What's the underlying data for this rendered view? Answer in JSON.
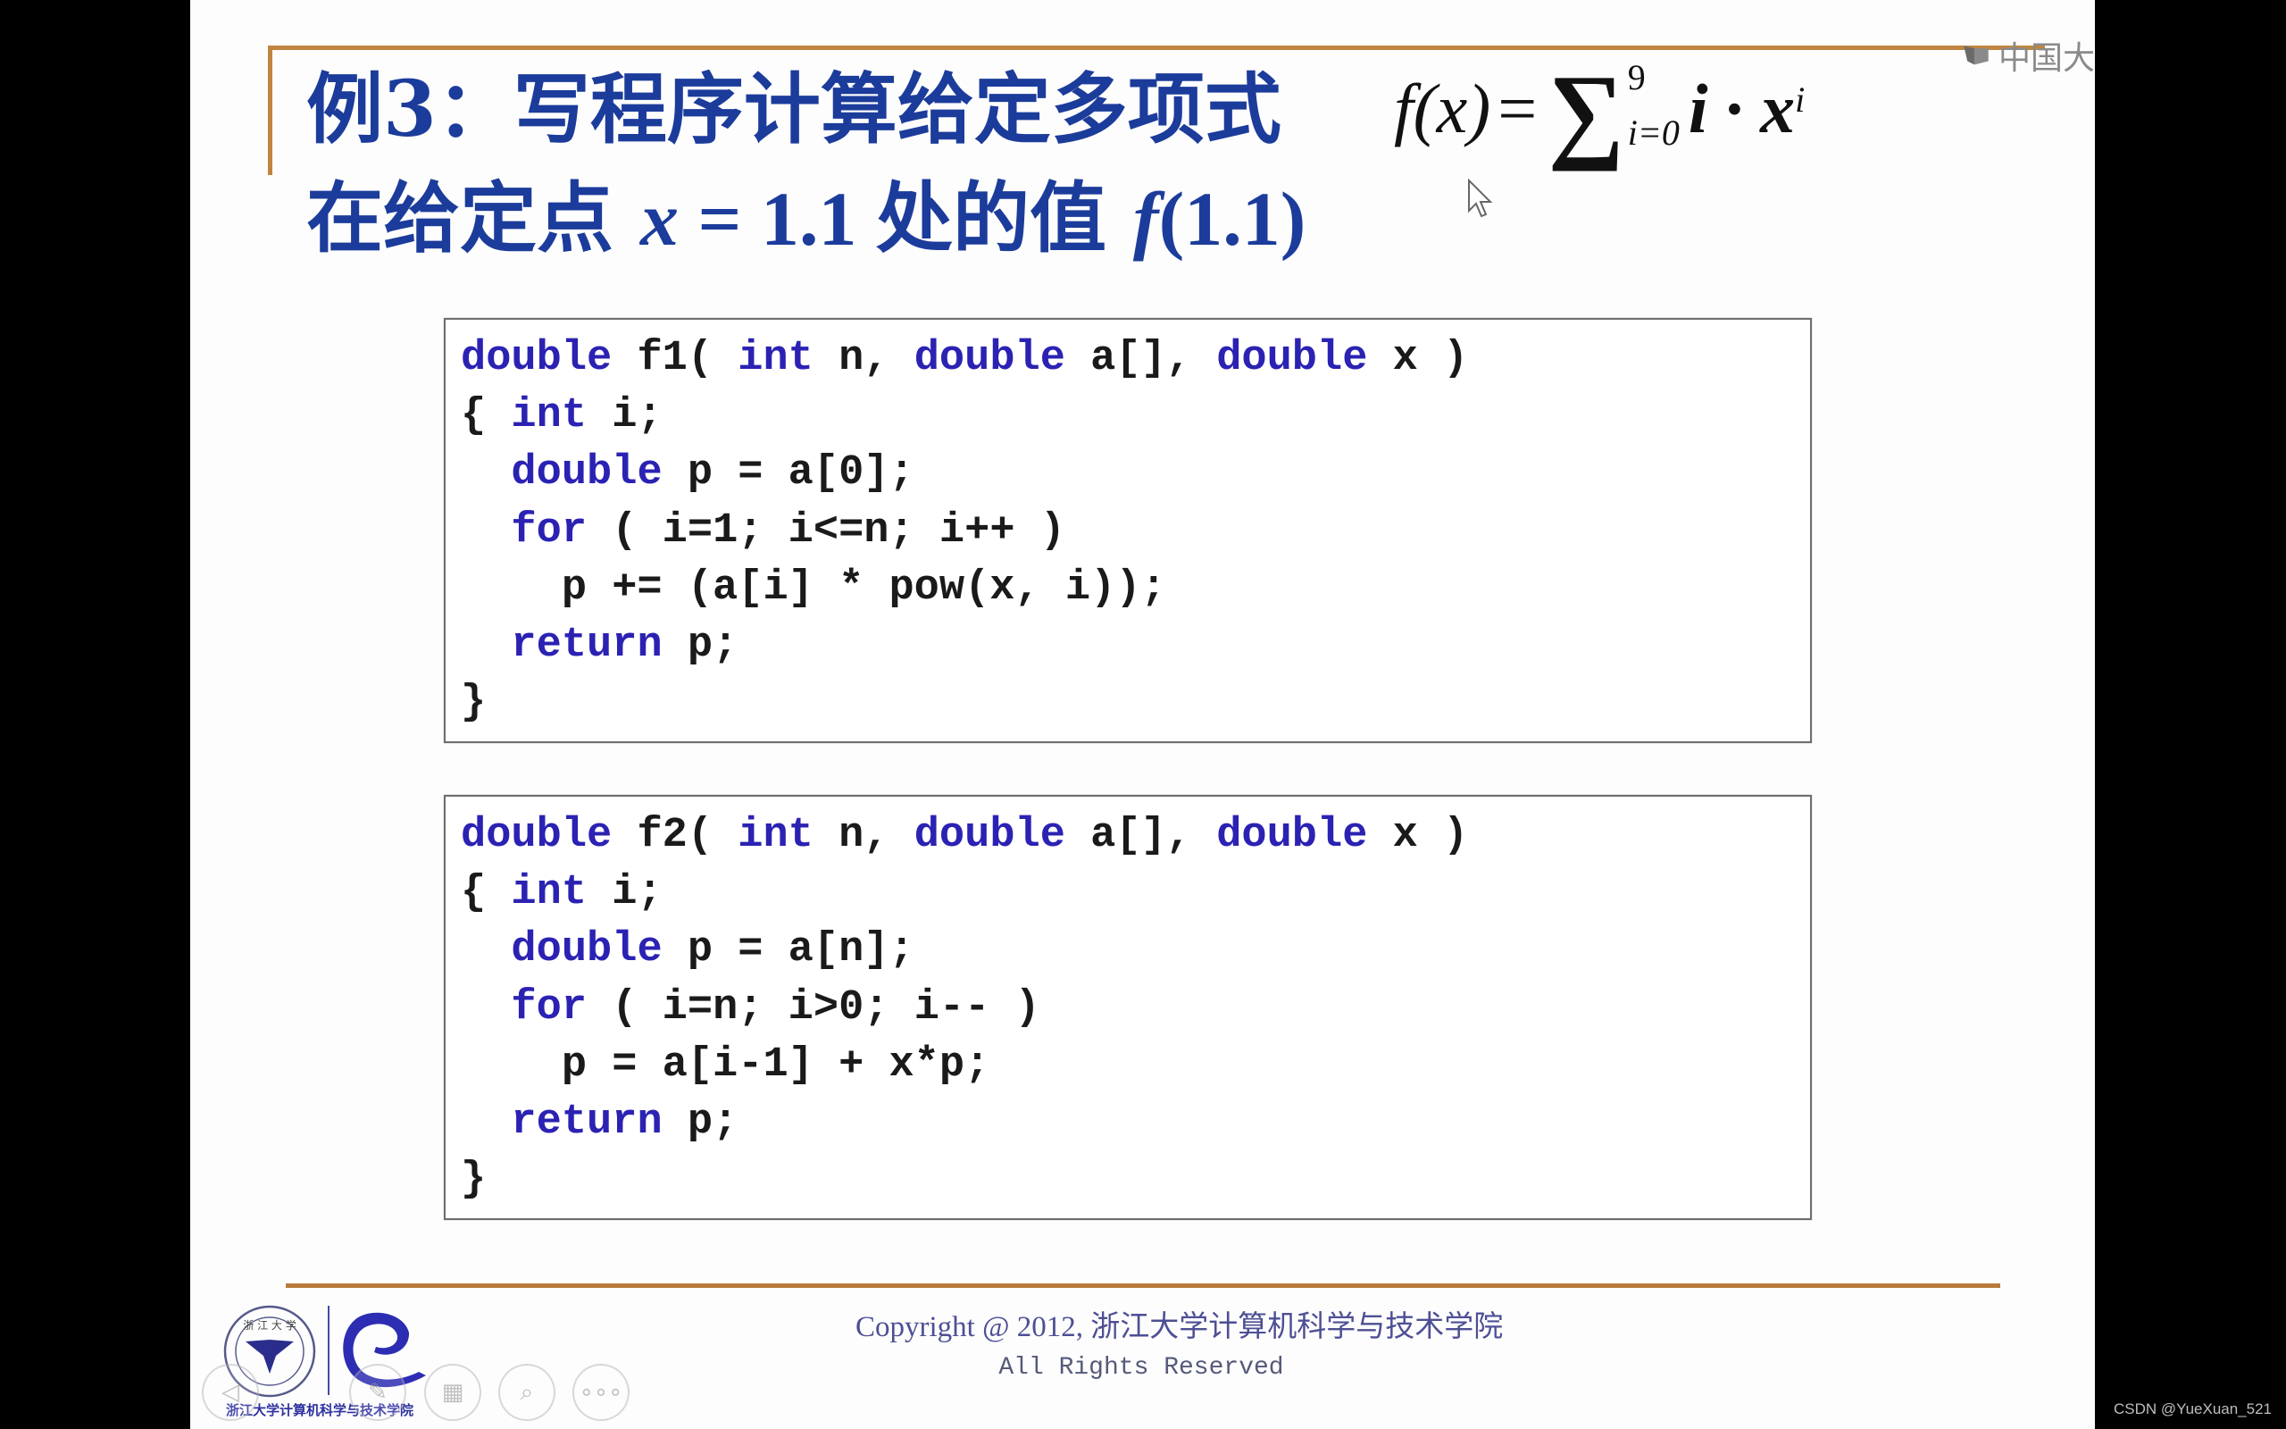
{
  "watermark": {
    "text": "中国大",
    "icon": "monitor-logo-icon"
  },
  "title": {
    "line1": "例3：写程序计算给定多项式",
    "line2_prefix": "在给定点",
    "line2_var": "x",
    "line2_eq": " = 1.1 ",
    "line2_mid": "处的值",
    "line2_f": "f",
    "line2_arg": "(1.1)"
  },
  "formula": {
    "lhs_f": "f",
    "lhs_paren": "(x)",
    "equals": "=",
    "sigma": "∑",
    "upper": "9",
    "lower": "i=0",
    "term": "i · x",
    "exponent": "i"
  },
  "code_blocks": [
    {
      "name": "f1",
      "lines": [
        [
          {
            "t": "double",
            "k": true
          },
          {
            "t": " f1( "
          },
          {
            "t": "int",
            "k": true
          },
          {
            "t": " n, "
          },
          {
            "t": "double",
            "k": true
          },
          {
            "t": " a[], "
          },
          {
            "t": "double",
            "k": true
          },
          {
            "t": " x )"
          }
        ],
        [
          {
            "t": "{ "
          },
          {
            "t": "int",
            "k": true
          },
          {
            "t": " i;"
          }
        ],
        [
          {
            "t": "  "
          },
          {
            "t": "double",
            "k": true
          },
          {
            "t": " p = a[0];"
          }
        ],
        [
          {
            "t": "  "
          },
          {
            "t": "for",
            "k": true
          },
          {
            "t": " ( i=1; i<=n; i++ )"
          }
        ],
        [
          {
            "t": "    p += (a[i] * pow(x, i));"
          }
        ],
        [
          {
            "t": "  "
          },
          {
            "t": "return",
            "k": true
          },
          {
            "t": " p;"
          }
        ],
        [
          {
            "t": "}"
          }
        ]
      ]
    },
    {
      "name": "f2",
      "lines": [
        [
          {
            "t": "double",
            "k": true
          },
          {
            "t": " f2( "
          },
          {
            "t": "int",
            "k": true
          },
          {
            "t": " n, "
          },
          {
            "t": "double",
            "k": true
          },
          {
            "t": " a[], "
          },
          {
            "t": "double",
            "k": true
          },
          {
            "t": " x )"
          }
        ],
        [
          {
            "t": "{ "
          },
          {
            "t": "int",
            "k": true
          },
          {
            "t": " i;"
          }
        ],
        [
          {
            "t": "  "
          },
          {
            "t": "double",
            "k": true
          },
          {
            "t": " p = a[n];"
          }
        ],
        [
          {
            "t": "  "
          },
          {
            "t": "for",
            "k": true
          },
          {
            "t": " ( i=n; i>0; i-- )"
          }
        ],
        [
          {
            "t": "    p = a[i-1] + x*p;"
          }
        ],
        [
          {
            "t": "  "
          },
          {
            "t": "return",
            "k": true
          },
          {
            "t": " p;"
          }
        ],
        [
          {
            "t": "}"
          }
        ]
      ]
    }
  ],
  "footer": {
    "copyright": "Copyright @ 2012, 浙江大学计算机科学与技术学院",
    "rights": "All Rights Reserved",
    "logo_caption": "浙江大学计算机科学与技术学院"
  },
  "controls": {
    "prev": "◁",
    "pen": "✎",
    "grid": "▦",
    "zoom": "⌕",
    "more": "∘∘∘"
  },
  "colors": {
    "title": "#1c3c9b",
    "keyword": "#2b22b3",
    "accent_line": "#c0853f"
  },
  "credit": "CSDN @YueXuan_521"
}
